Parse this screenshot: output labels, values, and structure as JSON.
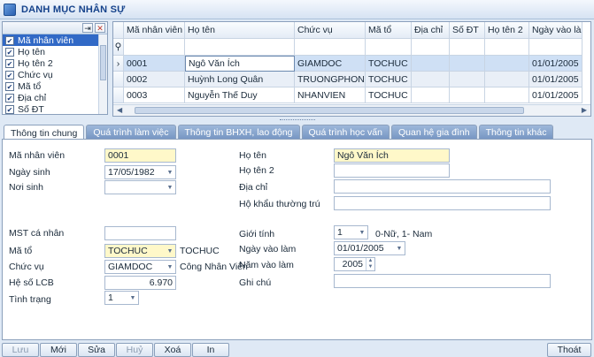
{
  "window": {
    "title": "DANH MỤC NHÂN SỰ"
  },
  "column_chooser": {
    "items": [
      {
        "label": "Mã nhân viên",
        "checked": true
      },
      {
        "label": "Họ tên",
        "checked": true
      },
      {
        "label": "Họ tên 2",
        "checked": true
      },
      {
        "label": "Chức vụ",
        "checked": true
      },
      {
        "label": "Mã tổ",
        "checked": true
      },
      {
        "label": "Địa chỉ",
        "checked": true
      },
      {
        "label": "Số ĐT",
        "checked": true
      }
    ]
  },
  "grid": {
    "columns": [
      "Mã nhân viên",
      "Họ tên",
      "Chức vụ",
      "Mã tổ",
      "Địa chỉ",
      "Số ĐT",
      "Họ tên 2",
      "Ngày vào làm"
    ],
    "rows": [
      [
        "0001",
        "Ngô Văn Ích",
        "GIAMDOC",
        "TOCHUC",
        "",
        "",
        "",
        "01/01/2005"
      ],
      [
        "0002",
        "Huỳnh Long Quân",
        "TRUONGPHONG",
        "TOCHUC",
        "",
        "",
        "",
        "01/01/2005"
      ],
      [
        "0003",
        "Nguyễn Thế Duy",
        "NHANVIEN",
        "TOCHUC",
        "",
        "",
        "",
        "01/01/2005"
      ]
    ],
    "current_row_marker": "›"
  },
  "tabs": [
    "Thông tin chung",
    "Quá trình làm việc",
    "Thông tin BHXH, lao động",
    "Quá trình học vấn",
    "Quan hệ gia đình",
    "Thông tin khác"
  ],
  "form": {
    "ma_nhan_vien_label": "Mã nhân viên",
    "ma_nhan_vien": "0001",
    "ngay_sinh_label": "Ngày sinh",
    "ngay_sinh": "17/05/1982",
    "noi_sinh_label": "Nơi sinh",
    "noi_sinh": "",
    "ho_ten_label": "Họ tên",
    "ho_ten": "Ngô Văn Ích",
    "ho_ten2_label": "Họ tên 2",
    "ho_ten2": "",
    "dia_chi_label": "Địa chỉ",
    "dia_chi": "",
    "ho_khau_label": "Hộ khẩu thường trú",
    "ho_khau": "",
    "mst_label": "MST cá nhân",
    "mst": "",
    "ma_to_label": "Mã tổ",
    "ma_to": "TOCHUC",
    "ma_to_name": "TOCHUC",
    "chuc_vu_label": "Chức vụ",
    "chuc_vu": "GIAMDOC",
    "chuc_vu_name": "Công Nhân Viên",
    "he_so_label": "Hệ số LCB",
    "he_so": "6.970",
    "tinh_trang_label": "Tình trạng",
    "tinh_trang": "1",
    "gioi_tinh_label": "Giới tính",
    "gioi_tinh": "1",
    "gioi_tinh_hint": "0-Nữ, 1- Nam",
    "ngay_vao_lam_label": "Ngày vào làm",
    "ngay_vao_lam": "01/01/2005",
    "nam_vao_lam_label": "Năm vào làm",
    "nam_vao_lam": "2005",
    "ghi_chu_label": "Ghi chú",
    "ghi_chu": ""
  },
  "buttons": {
    "luu": "Lưu",
    "moi": "Mới",
    "sua": "Sửa",
    "huy": "Huỷ",
    "xoa": "Xoá",
    "in": "In",
    "thoat": "Thoát"
  }
}
